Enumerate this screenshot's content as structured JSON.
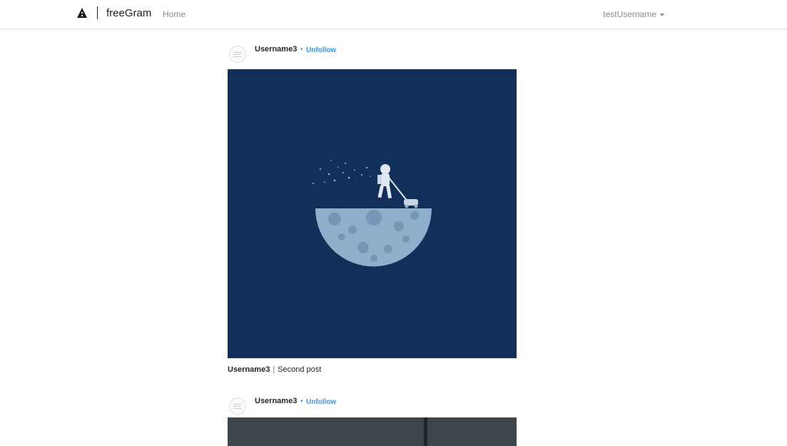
{
  "navbar": {
    "brand_name": "freeGram",
    "home_label": "Home",
    "username": "testUsername"
  },
  "posts": [
    {
      "username": "Username3",
      "follow_label": "Unfollow",
      "separator": "•",
      "caption_user": "Username3",
      "caption_separator": "|",
      "caption_text": "Second post",
      "image_description_colors": {
        "background": "#112f58",
        "moon": "#8fb0cc"
      }
    },
    {
      "username": "Username3",
      "follow_label": "Unfollow",
      "separator": "•"
    }
  ],
  "colors": {
    "link": "#3897f0",
    "nav_text": "#8a8a8a",
    "image_bg": "#112f58"
  }
}
